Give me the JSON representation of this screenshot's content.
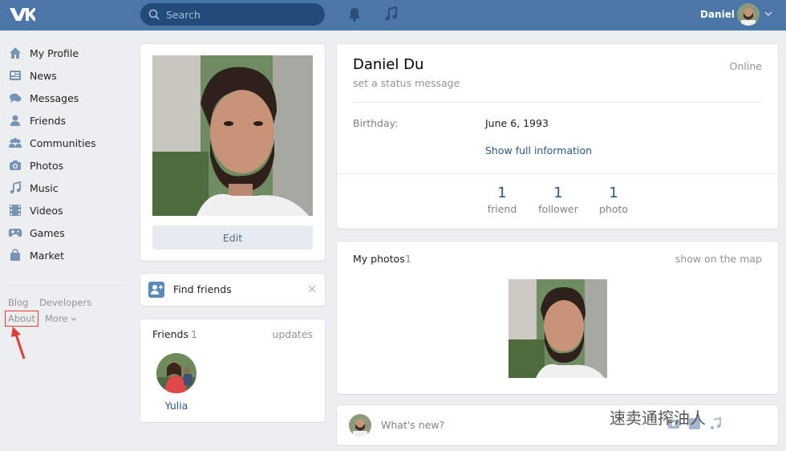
{
  "header": {
    "search_placeholder": "Search",
    "user_name": "Daniel"
  },
  "sidebar": {
    "items": [
      {
        "label": "My Profile",
        "icon": "home-icon"
      },
      {
        "label": "News",
        "icon": "news-icon"
      },
      {
        "label": "Messages",
        "icon": "messages-icon"
      },
      {
        "label": "Friends",
        "icon": "friends-icon"
      },
      {
        "label": "Communities",
        "icon": "communities-icon"
      },
      {
        "label": "Photos",
        "icon": "camera-icon"
      },
      {
        "label": "Music",
        "icon": "music-icon"
      },
      {
        "label": "Videos",
        "icon": "videos-icon"
      },
      {
        "label": "Games",
        "icon": "games-icon"
      },
      {
        "label": "Market",
        "icon": "market-icon"
      }
    ],
    "footer": {
      "blog": "Blog",
      "developers": "Developers",
      "about": "About",
      "more": "More"
    }
  },
  "photo_card": {
    "edit_label": "Edit"
  },
  "find_friends": {
    "label": "Find friends"
  },
  "friends": {
    "title": "Friends",
    "count": "1",
    "updates": "updates",
    "list": [
      {
        "name": "Yulia"
      }
    ]
  },
  "profile": {
    "name": "Daniel Du",
    "online": "Online",
    "status_placeholder": "set a status message",
    "birthday_label": "Birthday:",
    "birthday_value": "June 6, 1993",
    "show_full": "Show full information",
    "stats": [
      {
        "value": "1",
        "caption": "friend"
      },
      {
        "value": "1",
        "caption": "follower"
      },
      {
        "value": "1",
        "caption": "photo"
      }
    ]
  },
  "photos": {
    "title": "My photos",
    "count": "1",
    "show_map": "show on the map"
  },
  "post": {
    "placeholder": "What's new?"
  },
  "watermark": "速卖通搾油人",
  "colors": {
    "brand": "#4a76a8",
    "link": "#2a5885",
    "annotation": "#e53935"
  }
}
